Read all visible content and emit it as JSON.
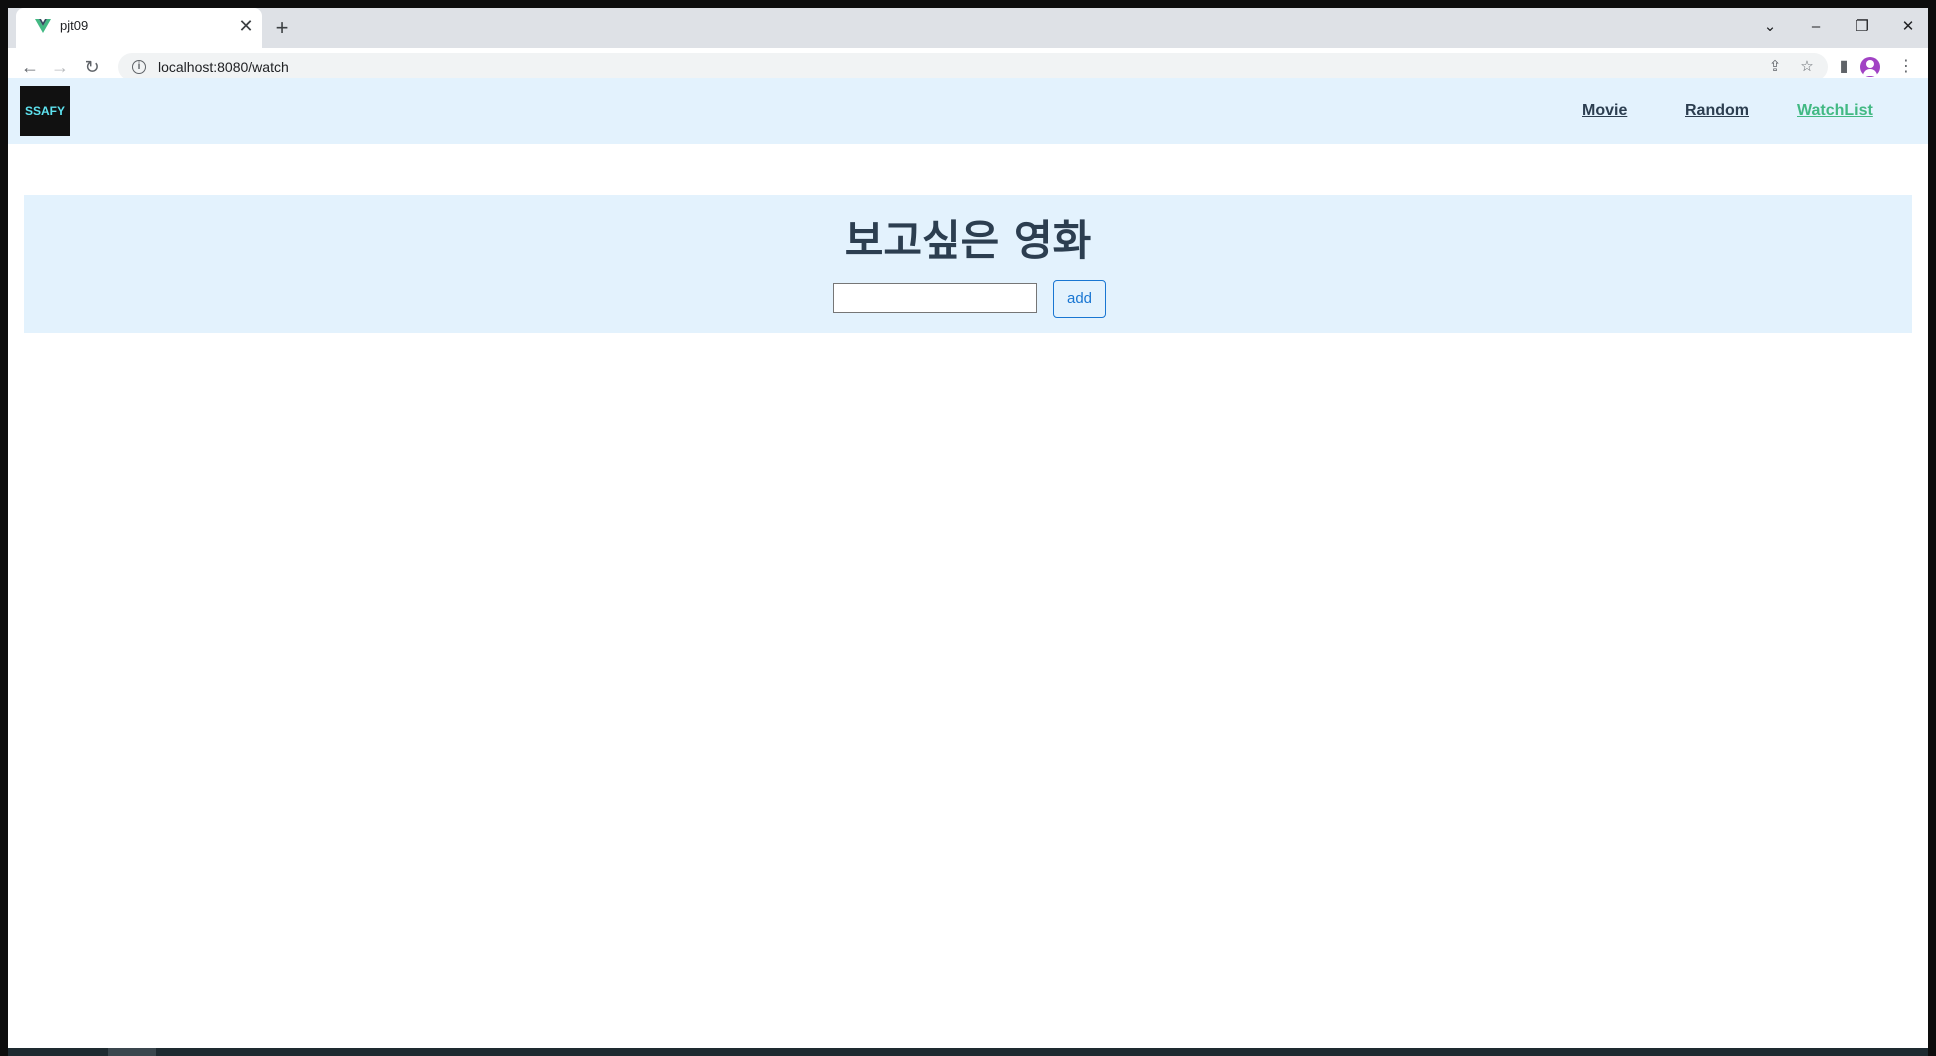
{
  "browser": {
    "tab": {
      "title": "pjt09",
      "close_glyph": "✕"
    },
    "new_tab_glyph": "+",
    "window_controls": {
      "tab_search": "⌄",
      "minimize": "–",
      "restore": "❐",
      "close": "✕"
    },
    "toolbar": {
      "back_glyph": "←",
      "forward_glyph": "→",
      "reload_glyph": "↻",
      "info_glyph": "i",
      "url": "localhost:8080/watch",
      "share_glyph": "⇪",
      "bookmark_glyph": "☆",
      "sidepanel_glyph": "▮",
      "menu_glyph": "⋮"
    }
  },
  "app": {
    "logo_text": "SSAFY",
    "nav": {
      "movie": "Movie",
      "random": "Random",
      "watchlist": "WatchList"
    },
    "watchlist": {
      "title": "보고싶은 영화",
      "input_value": "",
      "add_label": "add"
    }
  },
  "colors": {
    "nav_bg": "#e3f2fd",
    "link": "#2c3e50",
    "active_link": "#42b983",
    "button": "#1976d2"
  }
}
